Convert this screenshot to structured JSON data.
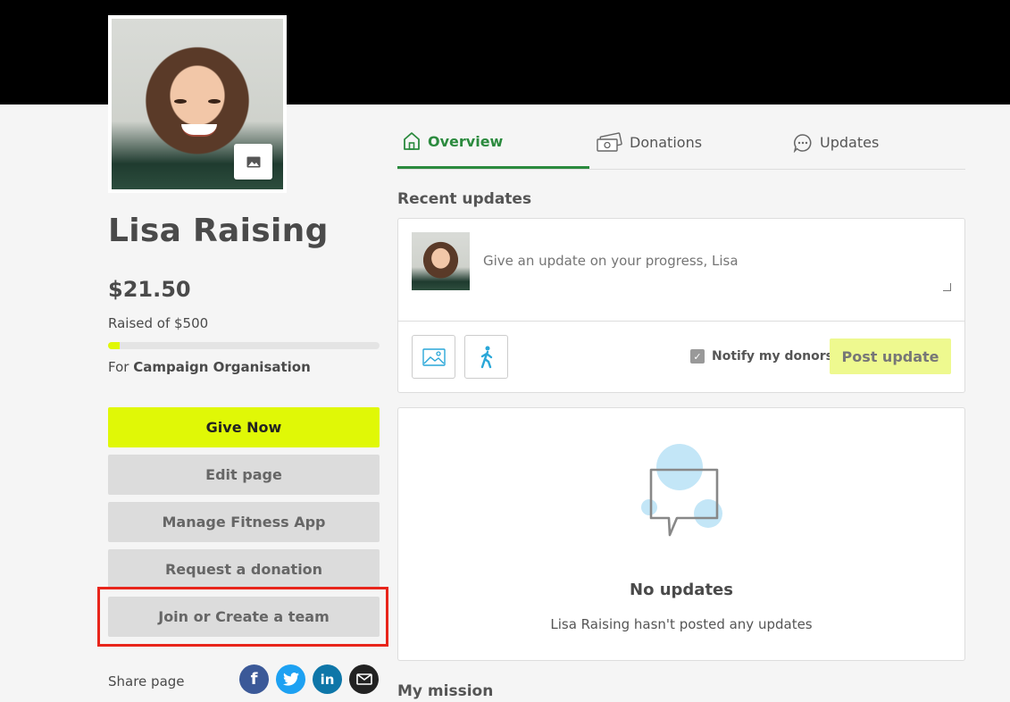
{
  "profile": {
    "name": "Lisa Raising",
    "amount_raised": "$21.50",
    "raised_of": "Raised of $500",
    "progress_fraction": 0.043,
    "for_prefix": "For",
    "organisation": "Campaign Organisation"
  },
  "actions": {
    "give_now": "Give Now",
    "edit_page": "Edit page",
    "manage_fitness": "Manage Fitness App",
    "request_donation": "Request a donation",
    "join_team": "Join or Create a team"
  },
  "share": {
    "label": "Share page",
    "icons": [
      "facebook-icon",
      "twitter-icon",
      "linkedin-icon",
      "email-icon"
    ]
  },
  "tabs": [
    {
      "label": "Overview",
      "icon": "home-icon",
      "active": true
    },
    {
      "label": "Donations",
      "icon": "money-icon",
      "active": false
    },
    {
      "label": "Updates",
      "icon": "chat-icon",
      "active": false
    }
  ],
  "recent_updates": {
    "title": "Recent updates",
    "placeholder": "Give an update on your progress, Lisa",
    "notify_label": "Notify my donors",
    "notify_checked": true,
    "post_button": "Post update"
  },
  "empty_state": {
    "title": "No updates",
    "subtitle": "Lisa Raising hasn't posted any updates"
  },
  "mission": {
    "title": "My mission"
  },
  "colors": {
    "accent": "#e0f806",
    "tab_active": "#2b8a3e",
    "highlight": "#e8251b"
  }
}
